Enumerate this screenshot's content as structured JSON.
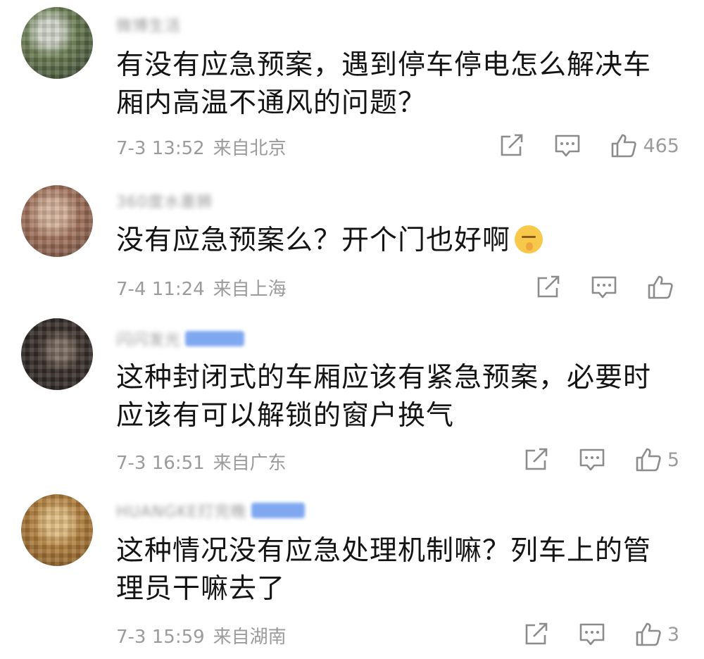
{
  "comments": [
    {
      "username": "微博生活",
      "badge": false,
      "avatar_colors": [
        "#6a7d52",
        "#2f3a2a",
        "#cfd4c8"
      ],
      "lines": [
        "有没有应急预案，遇到停车停电怎么解决车",
        "厢内高温不通风的问题？"
      ],
      "time": "7-3 13:52",
      "location": "来自北京",
      "like_count": "465"
    },
    {
      "username": "360度水墨狮",
      "badge": false,
      "avatar_colors": [
        "#a0705a",
        "#6b4a3c",
        "#d3b19a"
      ],
      "lines": [
        "没有应急预案么？开个门也好啊"
      ],
      "emoji": "shush-emoji",
      "time": "7-4 11:24",
      "location": "来自上海",
      "like_count": ""
    },
    {
      "username": "闪闪发光",
      "badge": true,
      "avatar_colors": [
        "#1e1e1e",
        "#3a2f2a",
        "#7a6a5e"
      ],
      "lines": [
        "这种封闭式的车厢应该有紧急预案，必要时",
        "应该有可以解锁的窗户换气"
      ],
      "time": "7-3 16:51",
      "location": "来自广东",
      "like_count": "5"
    },
    {
      "username": "HUANGKE打完晚",
      "badge": true,
      "avatar_colors": [
        "#b07d3a",
        "#7c5224",
        "#e0bc80"
      ],
      "lines": [
        "这种情况没有应急处理机制嘛？列车上的管",
        "理员干嘛去了"
      ],
      "time": "7-3 15:59",
      "location": "来自湖南",
      "like_count": "3"
    }
  ],
  "icons": {
    "share": "share-icon",
    "comment": "comment-icon",
    "like": "thumbs-up-icon"
  },
  "colors": {
    "text": "#141414",
    "meta": "#9b9b9b",
    "badge": "#7fa8f0"
  }
}
